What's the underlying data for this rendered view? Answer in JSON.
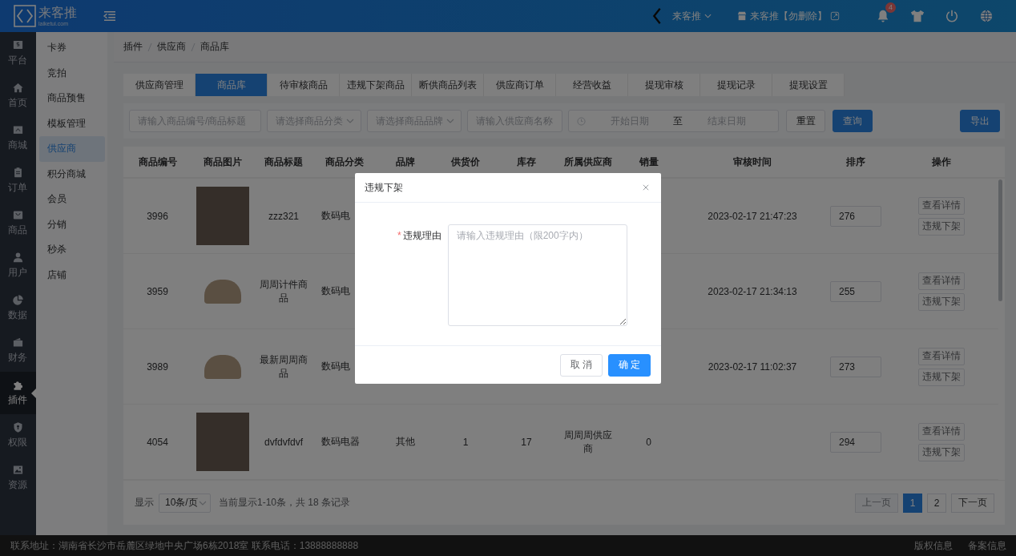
{
  "header": {
    "logo_title": "来客推",
    "logo_subtitle": "laiketui.com",
    "store_switch": "来客推",
    "store_switch_expanded": false,
    "shop_name": "来客推【勿删除】",
    "notifications": "4"
  },
  "nav_rail": [
    {
      "label": "平台",
      "selected": false
    },
    {
      "label": "首页",
      "selected": false
    },
    {
      "label": "商城",
      "selected": false
    },
    {
      "label": "订单",
      "selected": false
    },
    {
      "label": "商品",
      "selected": false
    },
    {
      "label": "用户",
      "selected": false
    },
    {
      "label": "数据",
      "selected": false
    },
    {
      "label": "财务",
      "selected": false
    },
    {
      "label": "插件",
      "selected": true
    },
    {
      "label": "权限",
      "selected": false
    },
    {
      "label": "资源",
      "selected": false
    }
  ],
  "submenu": [
    {
      "label": "卡券",
      "selected": false
    },
    {
      "label": "竞拍",
      "selected": false
    },
    {
      "label": "商品预售",
      "selected": false
    },
    {
      "label": "模板管理",
      "selected": false
    },
    {
      "label": "供应商",
      "selected": true
    },
    {
      "label": "积分商城",
      "selected": false
    },
    {
      "label": "会员",
      "selected": false
    },
    {
      "label": "分销",
      "selected": false
    },
    {
      "label": "秒杀",
      "selected": false
    },
    {
      "label": "店铺",
      "selected": false
    }
  ],
  "breadcrumb": [
    "插件",
    "供应商",
    "商品库"
  ],
  "tabs": [
    {
      "label": "供应商管理",
      "selected": false
    },
    {
      "label": "商品库",
      "selected": true
    },
    {
      "label": "待审核商品",
      "selected": false
    },
    {
      "label": "违规下架商品",
      "selected": false
    },
    {
      "label": "断供商品列表",
      "selected": false
    },
    {
      "label": "供应商订单",
      "selected": false
    },
    {
      "label": "经营收益",
      "selected": false
    },
    {
      "label": "提现审核",
      "selected": false
    },
    {
      "label": "提现记录",
      "selected": false
    },
    {
      "label": "提现设置",
      "selected": false
    }
  ],
  "filters": {
    "keyword_placeholder": "请输入商品编号/商品标题",
    "category_placeholder": "请选择商品分类",
    "brand_placeholder": "请选择商品品牌",
    "supplier_placeholder": "请输入供应商名称",
    "start_date_placeholder": "开始日期",
    "range_separator": "至",
    "end_date_placeholder": "结束日期",
    "buttons": [
      {
        "label": "重置",
        "kind": "plain"
      },
      {
        "label": "查询",
        "kind": "primary"
      }
    ],
    "export_button": "导出"
  },
  "table": {
    "columns": [
      "商品编号",
      "商品图片",
      "商品标题",
      "商品分类",
      "品牌",
      "供货价",
      "库存",
      "所属供应商",
      "销量",
      "审核时间",
      "排序",
      "操作"
    ],
    "rows": [
      {
        "id": "3996",
        "kind": "photo",
        "title": "zzz321",
        "category": "数码电",
        "audit_time": "2023-02-17 21:47:23",
        "sort": "276",
        "actions": [
          "查看详情",
          "违规下架"
        ]
      },
      {
        "id": "3959",
        "kind": "product",
        "title": "周周计件商品",
        "category": "数码电",
        "audit_time": "2023-02-17 21:34:13",
        "sort": "255",
        "actions": [
          "查看详情",
          "违规下架"
        ]
      },
      {
        "id": "3989",
        "kind": "product",
        "title": "最新周周商品",
        "category": "数码电",
        "audit_time": "2023-02-17 11:02:37",
        "sort": "273",
        "actions": [
          "查看详情",
          "违规下架"
        ]
      },
      {
        "id": "4054",
        "kind": "photo",
        "title": "dvfdvfdvf",
        "category": "数码电器",
        "brand": "其他",
        "supply_price": "1",
        "stock": "17",
        "supplier": "周周周供应商",
        "sales": "0",
        "sort": "294",
        "actions": [
          "查看详情",
          "违规下架"
        ]
      }
    ]
  },
  "pagination": {
    "show_label": "显示",
    "page_size": "10条/页",
    "summary": "当前显示1-10条，共 18 条记录",
    "prev": {
      "label": "上一页",
      "disabled": true
    },
    "pages": [
      {
        "label": "1",
        "selected": true
      },
      {
        "label": "2",
        "selected": false
      }
    ],
    "next": {
      "label": "下一页",
      "disabled": false
    }
  },
  "dialog": {
    "title": "违规下架",
    "required_mark": "*",
    "field_label": "违规理由",
    "placeholder": "请输入违规理由（限200字内）",
    "buttons": [
      {
        "label": "取 消",
        "kind": "plain"
      },
      {
        "label": "确 定",
        "kind": "primary"
      }
    ]
  },
  "footer": {
    "contact": "联系地址：湖南省长沙市岳麓区绿地中央广场6栋2018室 联系电话：13888888888",
    "links": [
      "版权信息",
      "备案信息"
    ]
  }
}
